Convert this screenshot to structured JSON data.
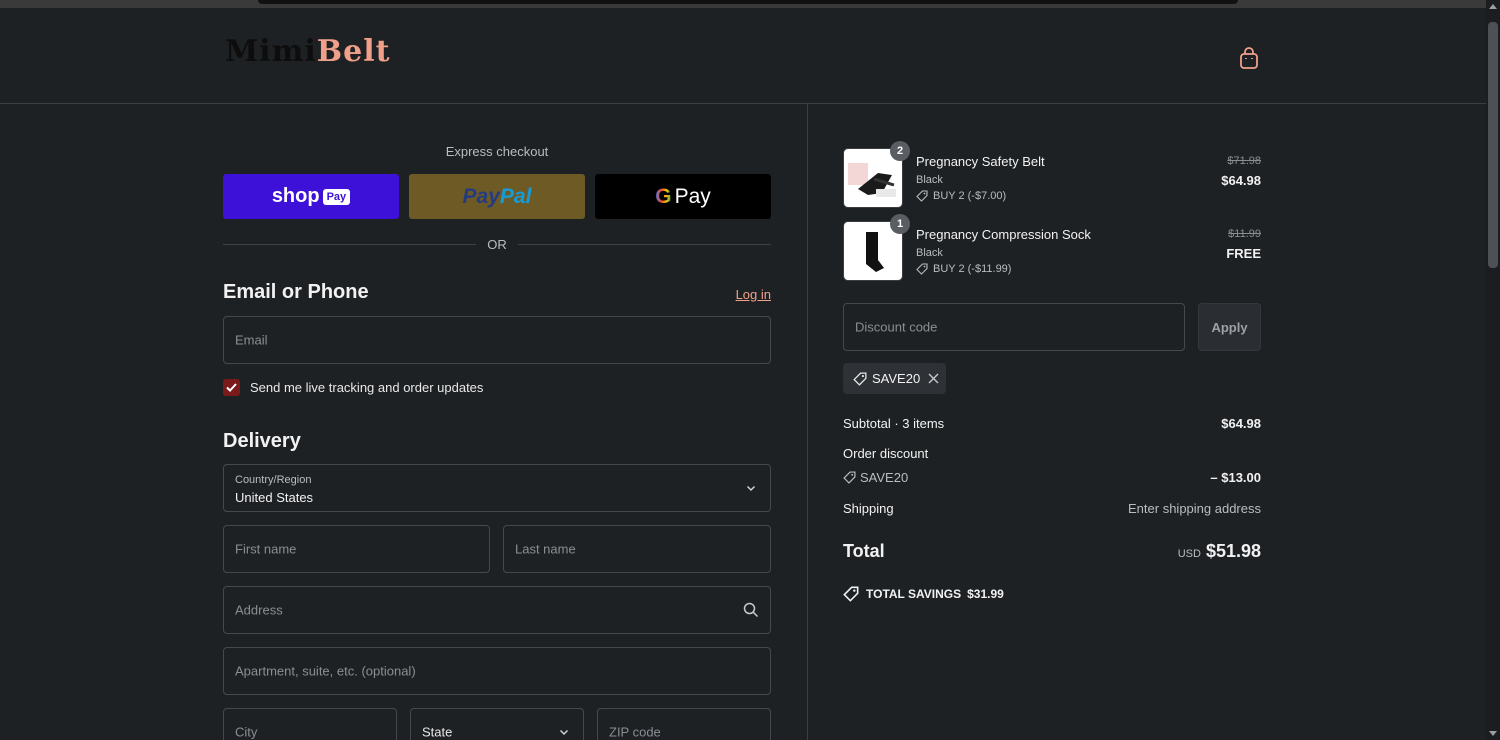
{
  "brand": {
    "part1": "Mimi",
    "part2": "Belt"
  },
  "express": {
    "label": "Express checkout",
    "shop_text": "shop",
    "shop_badge": "Pay",
    "paypal_1": "Pay",
    "paypal_2": "Pal",
    "gpay_g": "G",
    "gpay_text": "Pay",
    "or": "OR"
  },
  "contact": {
    "title": "Email or Phone",
    "login": "Log in",
    "email_placeholder": "Email",
    "updates_label": "Send me live tracking and order updates",
    "updates_checked": true
  },
  "delivery": {
    "title": "Delivery",
    "country_label": "Country/Region",
    "country_value": "United States",
    "first_name": "First name",
    "last_name": "Last name",
    "address": "Address",
    "apartment": "Apartment, suite, etc. (optional)",
    "city": "City",
    "state": "State",
    "zip": "ZIP code"
  },
  "cart": {
    "items": [
      {
        "name": "Pregnancy Safety Belt",
        "variant": "Black",
        "qty": "2",
        "promo": "BUY 2 (-$7.00)",
        "price_old": "$71.98",
        "price_new": "$64.98"
      },
      {
        "name": "Pregnancy Compression Sock",
        "variant": "Black",
        "qty": "1",
        "promo": "BUY 2 (-$11.99)",
        "price_old": "$11.99",
        "price_new": "FREE"
      }
    ],
    "discount_placeholder": "Discount code",
    "apply": "Apply",
    "applied_code": "SAVE20"
  },
  "summary": {
    "subtotal_label": "Subtotal · 3 items",
    "subtotal_value": "$64.98",
    "order_discount_label": "Order discount",
    "discount_code": "SAVE20",
    "discount_value": "– $13.00",
    "shipping_label": "Shipping",
    "shipping_value": "Enter shipping address",
    "total_label": "Total",
    "currency": "USD",
    "total_value": "$51.98",
    "savings_label": "TOTAL SAVINGS",
    "savings_value": "$31.99"
  },
  "colors": {
    "accent": "#f0a08a",
    "shop": "#3d11d8",
    "paypal_bg": "#6e5a25",
    "checkbox": "#7a1a1a"
  }
}
